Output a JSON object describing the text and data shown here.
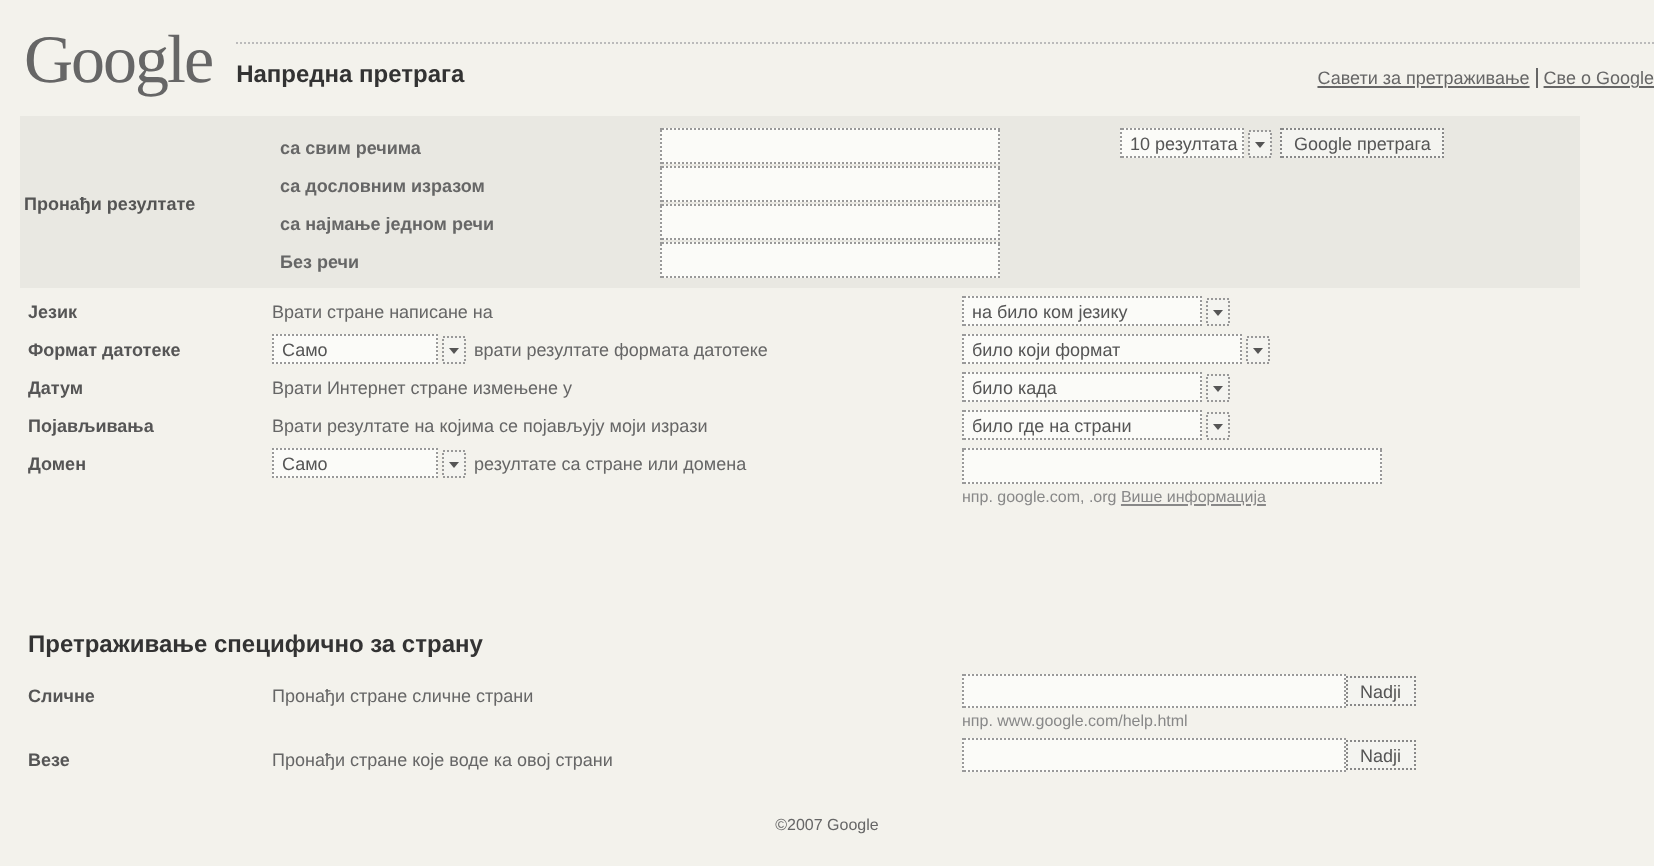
{
  "header": {
    "logo": "Google",
    "title": "Напредна претрага",
    "links": [
      "Савети за претраживање",
      "Све о Google"
    ]
  },
  "find_results": {
    "label": "Пронађи резултате",
    "rows": [
      {
        "label": "са свим речима"
      },
      {
        "label": "са дословним изразом"
      },
      {
        "label": "са најмање једном речи"
      },
      {
        "label": "Без речи"
      }
    ],
    "results_select": "10 резултата",
    "search_button": "Google претрага"
  },
  "options": [
    {
      "kind": "text",
      "label": "Језик",
      "text": "Врати стране написане на",
      "select": "на било ком језику"
    },
    {
      "kind": "prefix",
      "label": "Формат датотеке",
      "prefix_select": "Само",
      "text": "врати резултате формата датотеке",
      "select": "било који формат"
    },
    {
      "kind": "text",
      "label": "Датум",
      "text": "Врати Интернет стране измењене у",
      "select": "било када"
    },
    {
      "kind": "text",
      "label": "Појављивања",
      "text": "Врати резултате на којима се појављују моји изрази",
      "select": "било где на страни"
    },
    {
      "kind": "field",
      "label": "Домен",
      "prefix_select": "Само",
      "text": "резултате са стране или домена",
      "hint": "нпр. google.com, .org",
      "hint_link": "Више информација"
    }
  ],
  "page_specific": {
    "heading": "Претраживање специфично за страну",
    "rows": [
      {
        "label": "Сличне",
        "text": "Пронађи стране сличне страни",
        "button": "Nadji",
        "hint": "нпр. www.google.com/help.html"
      },
      {
        "label": "Везе",
        "text": "Пронађи стране које воде ка овој страни",
        "button": "Nadji"
      }
    ]
  },
  "footer": "©2007 Google"
}
